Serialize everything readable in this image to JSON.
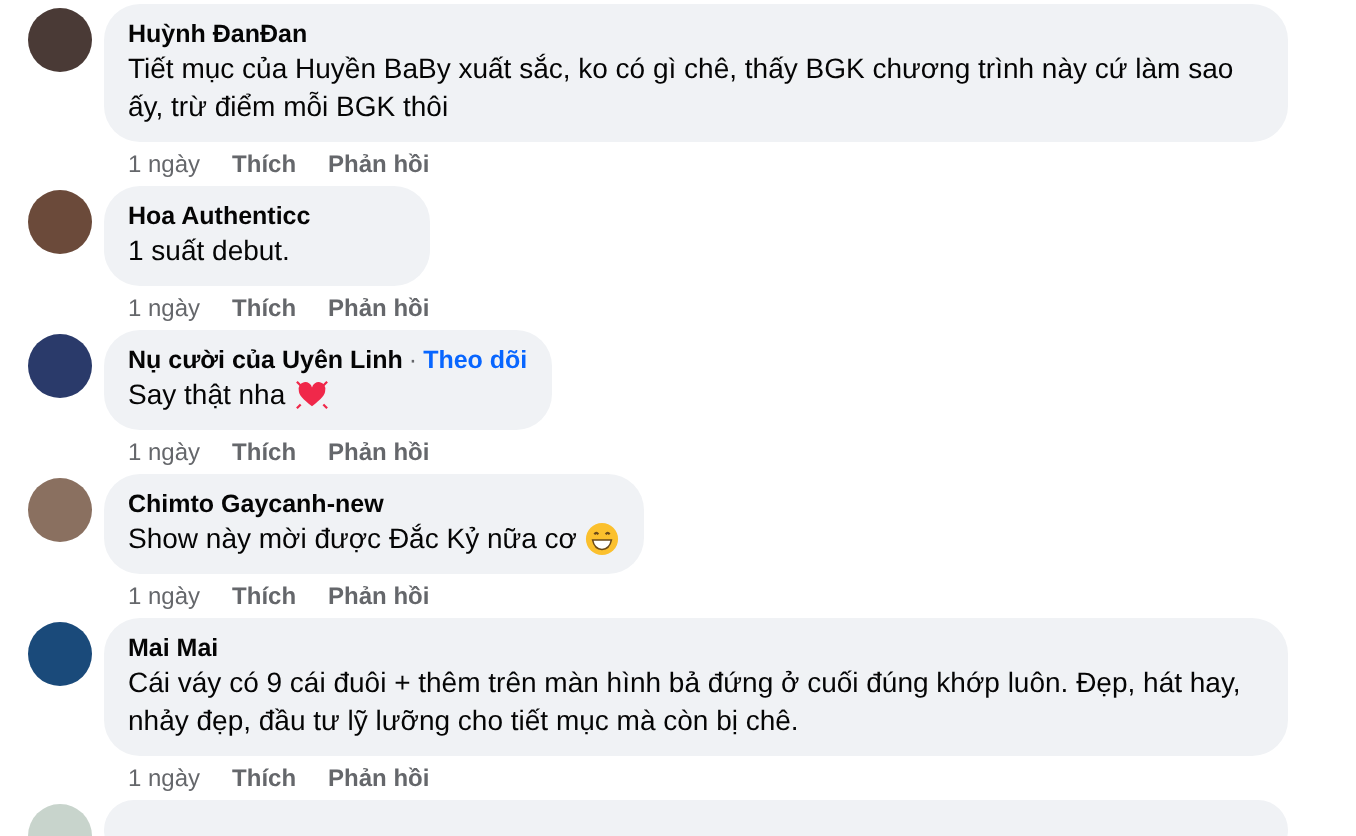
{
  "comments": [
    {
      "kind": "comment",
      "author": "Huỳnh ĐanĐan",
      "text": "Tiết mục của Huyền BaBy xuất sắc, ko có gì chê, thấy BGK chương trình này cứ làm sao ấy, trừ điểm mỗi BGK thôi",
      "time": "1 ngày",
      "like": "Thích",
      "reply": "Phản hồi"
    },
    {
      "kind": "comment",
      "author": "Hoa Authenticc",
      "text": "1 suất debut.",
      "time": "1 ngày",
      "like": "Thích",
      "reply": "Phản hồi"
    },
    {
      "kind": "comment",
      "author": "Nụ cười của Uyên Linh",
      "separator": "·",
      "follow": "Theo dõi",
      "text": "Say thật nha",
      "emoji": {
        "kind": "heart"
      },
      "time": "1 ngày",
      "like": "Thích",
      "reply": "Phản hồi"
    },
    {
      "kind": "comment",
      "author": "Chimto Gaycanh-new",
      "text": "Show này mời được Đắc Kỷ nữa cơ",
      "emoji": {
        "kind": "grin"
      },
      "time": "1 ngày",
      "like": "Thích",
      "reply": "Phản hồi"
    },
    {
      "kind": "comment",
      "author": "Mai Mai",
      "text": "Cái váy có 9 cái đuôi + thêm trên màn hình bả đứng ở cuối đúng khớp luôn. Đẹp, hát hay, nhảy đẹp, đầu tư lỹ lưỡng cho tiết mục mà còn bị chê.",
      "time": "1 ngày",
      "like": "Thích",
      "reply": "Phản hồi"
    },
    {
      "kind": "cut_off"
    }
  ]
}
